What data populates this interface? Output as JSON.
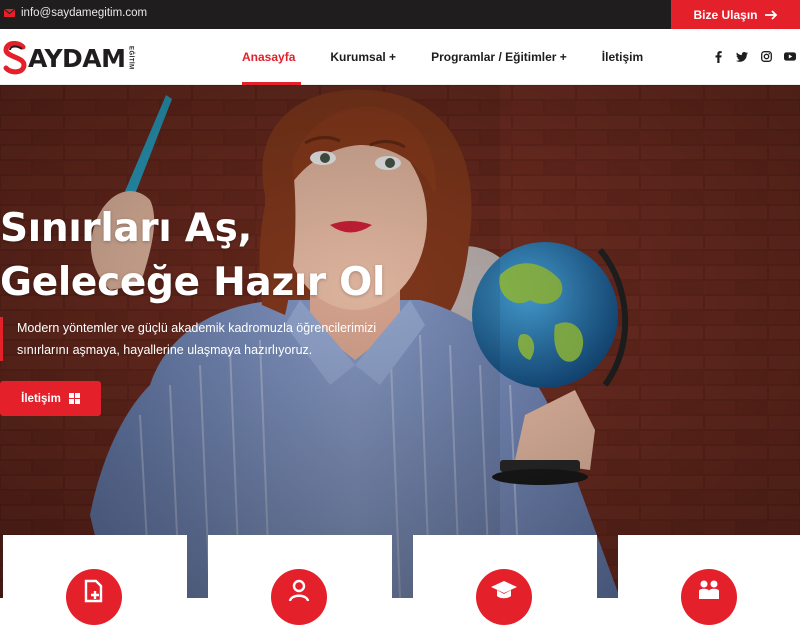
{
  "topbar": {
    "email": "info@saydamegitim.com",
    "email_icon": "envelope-icon",
    "cta_label": "Bize Ulaşın",
    "cta_icon": "arrow-right-icon"
  },
  "logo": {
    "word_accent": "S",
    "word_rest": "AYDAM",
    "sub": "EĞİTİM"
  },
  "nav": {
    "items": [
      {
        "label": "Anasayfa",
        "active": true
      },
      {
        "label": "Kurumsal +"
      },
      {
        "label": "Programlar / Eğitimler +"
      },
      {
        "label": "İletişim"
      }
    ]
  },
  "social": [
    "facebook-icon",
    "twitter-icon",
    "instagram-icon",
    "youtube-icon"
  ],
  "hero": {
    "title_line1": "Sınırları Aş,",
    "title_line2": "Geleceğe Hazır Ol",
    "desc_line1": "Modern yöntemler ve güçlü akademik kadromuzla öğrencilerimizi",
    "desc_line2": "sınırlarını aşmaya, hayallerine ulaşmaya hazırlıyoruz.",
    "button_label": "İletişim",
    "button_icon": "grid-icon"
  },
  "cards": [
    {
      "icon": "document-plus-icon"
    },
    {
      "icon": "user-icon"
    },
    {
      "icon": "graduation-cap-icon"
    },
    {
      "icon": "people-icon"
    }
  ],
  "colors": {
    "accent": "#e4202b",
    "dark": "#1f1d1e"
  }
}
